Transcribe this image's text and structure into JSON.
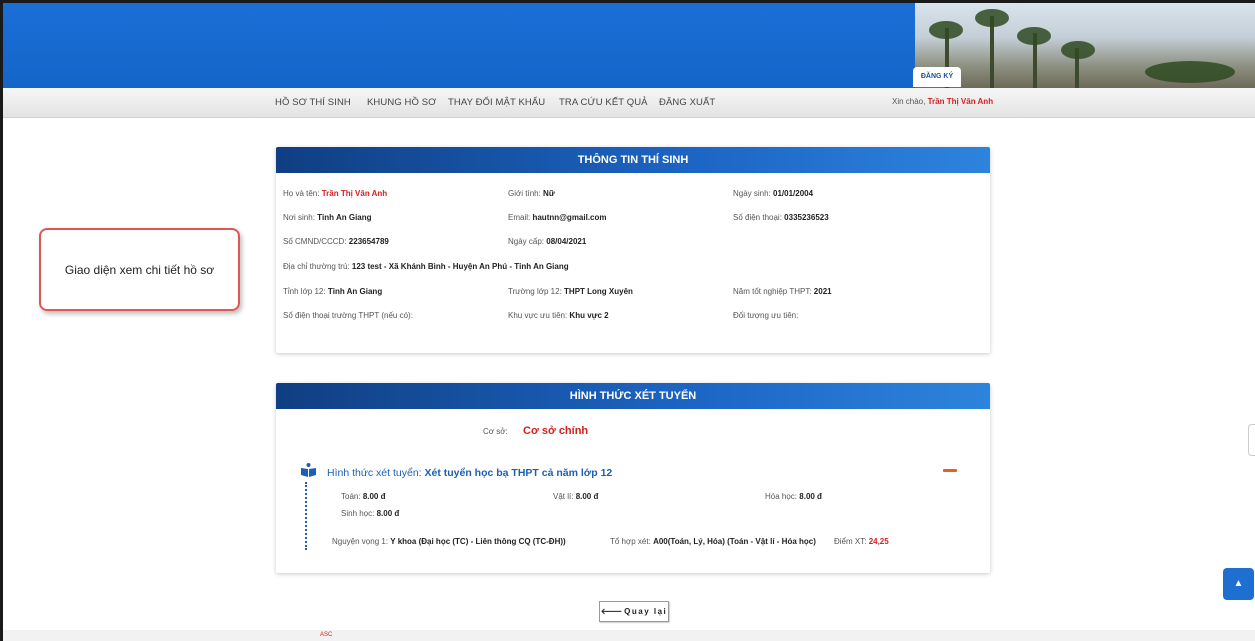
{
  "header": {
    "register_tab": "ĐĂNG KÝ"
  },
  "nav": {
    "items": [
      "HỒ SƠ THÍ SINH",
      "KHUNG HỒ SƠ",
      "THAY ĐỔI MẬT KHẨU",
      "TRA CỨU KẾT QUẢ",
      "ĐĂNG XUẤT"
    ],
    "greeting_prefix": "Xin chào,",
    "user_name": "Trần Thị Vân Anh"
  },
  "callout": "Giao diện xem chi tiết hồ sơ",
  "candidate": {
    "title": "THÔNG TIN THÍ SINH",
    "fields": [
      {
        "label": "Họ và tên:",
        "value": "Trần Thị Vân Anh"
      },
      {
        "label": "Giới tính:",
        "value": "Nữ"
      },
      {
        "label": "Ngày sinh:",
        "value": "01/01/2004"
      },
      {
        "label": "Nơi sinh:",
        "value": "Tỉnh An Giang"
      },
      {
        "label": "Email:",
        "value": "hautnn@gmail.com"
      },
      {
        "label": "Số điện thoại:",
        "value": "0335236523"
      },
      {
        "label": "Số CMND/CCCD:",
        "value": "223654789"
      },
      {
        "label": "Ngày cấp:",
        "value": "08/04/2021"
      },
      {
        "label": "Địa chỉ thường trú:",
        "value": "123 test - Xã Khánh Bình - Huyện An Phú - Tỉnh An Giang"
      },
      {
        "label": "Tỉnh lớp 12:",
        "value": "Tỉnh An Giang"
      },
      {
        "label": "Trường lớp 12:",
        "value": "THPT Long Xuyên"
      },
      {
        "label": "Năm tốt nghiệp THPT:",
        "value": "2021"
      },
      {
        "label": "Số điện thoại trường THPT (nếu có):",
        "value": ""
      },
      {
        "label": "Khu vực ưu tiên:",
        "value": "Khu vực 2"
      },
      {
        "label": "Đối tượng ưu tiên:",
        "value": ""
      }
    ]
  },
  "admission": {
    "title": "HÌNH THỨC XÉT TUYỂN",
    "campus_label": "Cơ sở:",
    "campus_value": "Cơ sở chính",
    "method_label": "Hình thức xét tuyển:",
    "method_value": "Xét tuyển học bạ THPT cả năm lớp 12",
    "scores": [
      {
        "label": "Toán:",
        "value": "8.00 đ"
      },
      {
        "label": "Vật lí:",
        "value": "8.00 đ"
      },
      {
        "label": "Hóa học:",
        "value": "8.00 đ"
      },
      {
        "label": "Sinh học:",
        "value": "8.00 đ"
      }
    ],
    "wish_label": "Nguyện vọng 1:",
    "wish_value": "Y khoa (Đại học (TC) - Liên thông CQ (TC-ĐH))",
    "combo_label": "Tổ hợp xét:",
    "combo_value": "A00(Toán, Lý, Hóa) (Toán - Vật lí - Hóa học)",
    "score_label": "Điểm XT:",
    "score_value": "24,25"
  },
  "back_button": "Quay lại",
  "footer_text": "ASC",
  "colors": {
    "banner": "#1565c8",
    "header_bar": "#1d66c6",
    "accent_red": "#d32020",
    "collapse": "#e8601c"
  }
}
